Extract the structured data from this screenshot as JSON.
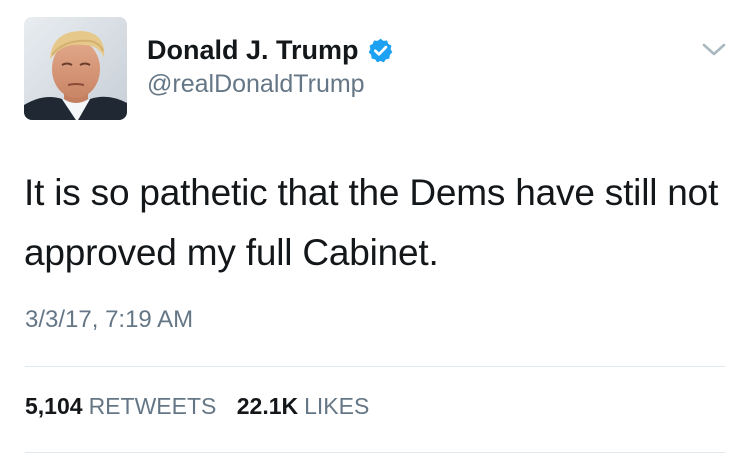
{
  "author": {
    "display_name": "Donald J. Trump",
    "handle": "@realDonaldTrump",
    "verified": true
  },
  "tweet": {
    "text": "It is so pathetic that the Dems have still not approved my full Cabinet.",
    "timestamp": "3/3/17, 7:19 AM"
  },
  "stats": {
    "retweets_count": "5,104",
    "retweets_label": "RETWEETS",
    "likes_count": "22.1K",
    "likes_label": "LIKES"
  },
  "icons": {
    "verified": "verified-badge-icon",
    "menu": "chevron-down-icon"
  },
  "colors": {
    "verified_blue": "#1da1f2",
    "secondary_text": "#657786",
    "primary_text": "#14171a",
    "divider": "#e1e8ed"
  }
}
